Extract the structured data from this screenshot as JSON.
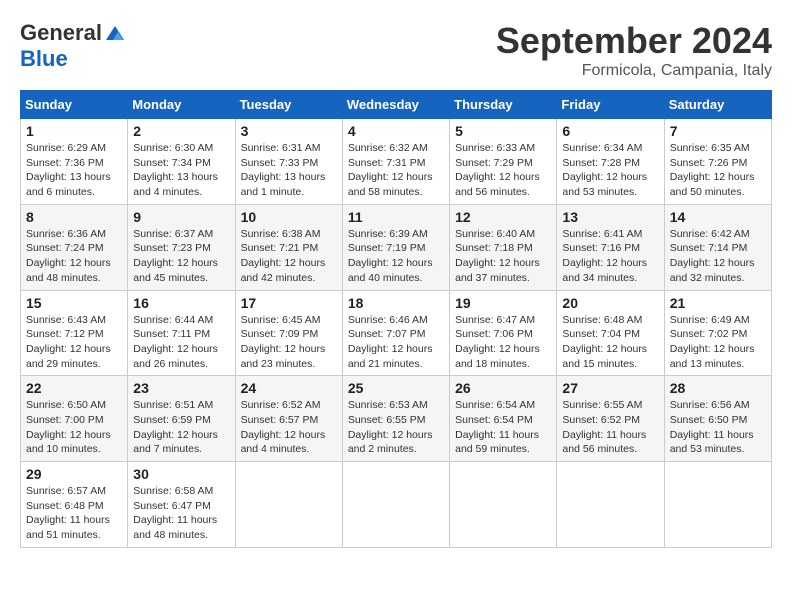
{
  "header": {
    "logo": {
      "general": "General",
      "blue": "Blue"
    },
    "title": "September 2024",
    "location": "Formicola, Campania, Italy"
  },
  "calendar": {
    "columns": [
      "Sunday",
      "Monday",
      "Tuesday",
      "Wednesday",
      "Thursday",
      "Friday",
      "Saturday"
    ],
    "weeks": [
      [
        null,
        null,
        null,
        null,
        null,
        null,
        null
      ]
    ],
    "days": {
      "1": {
        "num": "1",
        "sunrise": "6:29 AM",
        "sunset": "7:36 PM",
        "daylight": "13 hours and 6 minutes."
      },
      "2": {
        "num": "2",
        "sunrise": "6:30 AM",
        "sunset": "7:34 PM",
        "daylight": "13 hours and 4 minutes."
      },
      "3": {
        "num": "3",
        "sunrise": "6:31 AM",
        "sunset": "7:33 PM",
        "daylight": "13 hours and 1 minute."
      },
      "4": {
        "num": "4",
        "sunrise": "6:32 AM",
        "sunset": "7:31 PM",
        "daylight": "12 hours and 58 minutes."
      },
      "5": {
        "num": "5",
        "sunrise": "6:33 AM",
        "sunset": "7:29 PM",
        "daylight": "12 hours and 56 minutes."
      },
      "6": {
        "num": "6",
        "sunrise": "6:34 AM",
        "sunset": "7:28 PM",
        "daylight": "12 hours and 53 minutes."
      },
      "7": {
        "num": "7",
        "sunrise": "6:35 AM",
        "sunset": "7:26 PM",
        "daylight": "12 hours and 50 minutes."
      },
      "8": {
        "num": "8",
        "sunrise": "6:36 AM",
        "sunset": "7:24 PM",
        "daylight": "12 hours and 48 minutes."
      },
      "9": {
        "num": "9",
        "sunrise": "6:37 AM",
        "sunset": "7:23 PM",
        "daylight": "12 hours and 45 minutes."
      },
      "10": {
        "num": "10",
        "sunrise": "6:38 AM",
        "sunset": "7:21 PM",
        "daylight": "12 hours and 42 minutes."
      },
      "11": {
        "num": "11",
        "sunrise": "6:39 AM",
        "sunset": "7:19 PM",
        "daylight": "12 hours and 40 minutes."
      },
      "12": {
        "num": "12",
        "sunrise": "6:40 AM",
        "sunset": "7:18 PM",
        "daylight": "12 hours and 37 minutes."
      },
      "13": {
        "num": "13",
        "sunrise": "6:41 AM",
        "sunset": "7:16 PM",
        "daylight": "12 hours and 34 minutes."
      },
      "14": {
        "num": "14",
        "sunrise": "6:42 AM",
        "sunset": "7:14 PM",
        "daylight": "12 hours and 32 minutes."
      },
      "15": {
        "num": "15",
        "sunrise": "6:43 AM",
        "sunset": "7:12 PM",
        "daylight": "12 hours and 29 minutes."
      },
      "16": {
        "num": "16",
        "sunrise": "6:44 AM",
        "sunset": "7:11 PM",
        "daylight": "12 hours and 26 minutes."
      },
      "17": {
        "num": "17",
        "sunrise": "6:45 AM",
        "sunset": "7:09 PM",
        "daylight": "12 hours and 23 minutes."
      },
      "18": {
        "num": "18",
        "sunrise": "6:46 AM",
        "sunset": "7:07 PM",
        "daylight": "12 hours and 21 minutes."
      },
      "19": {
        "num": "19",
        "sunrise": "6:47 AM",
        "sunset": "7:06 PM",
        "daylight": "12 hours and 18 minutes."
      },
      "20": {
        "num": "20",
        "sunrise": "6:48 AM",
        "sunset": "7:04 PM",
        "daylight": "12 hours and 15 minutes."
      },
      "21": {
        "num": "21",
        "sunrise": "6:49 AM",
        "sunset": "7:02 PM",
        "daylight": "12 hours and 13 minutes."
      },
      "22": {
        "num": "22",
        "sunrise": "6:50 AM",
        "sunset": "7:00 PM",
        "daylight": "12 hours and 10 minutes."
      },
      "23": {
        "num": "23",
        "sunrise": "6:51 AM",
        "sunset": "6:59 PM",
        "daylight": "12 hours and 7 minutes."
      },
      "24": {
        "num": "24",
        "sunrise": "6:52 AM",
        "sunset": "6:57 PM",
        "daylight": "12 hours and 4 minutes."
      },
      "25": {
        "num": "25",
        "sunrise": "6:53 AM",
        "sunset": "6:55 PM",
        "daylight": "12 hours and 2 minutes."
      },
      "26": {
        "num": "26",
        "sunrise": "6:54 AM",
        "sunset": "6:54 PM",
        "daylight": "11 hours and 59 minutes."
      },
      "27": {
        "num": "27",
        "sunrise": "6:55 AM",
        "sunset": "6:52 PM",
        "daylight": "11 hours and 56 minutes."
      },
      "28": {
        "num": "28",
        "sunrise": "6:56 AM",
        "sunset": "6:50 PM",
        "daylight": "11 hours and 53 minutes."
      },
      "29": {
        "num": "29",
        "sunrise": "6:57 AM",
        "sunset": "6:48 PM",
        "daylight": "11 hours and 51 minutes."
      },
      "30": {
        "num": "30",
        "sunrise": "6:58 AM",
        "sunset": "6:47 PM",
        "daylight": "11 hours and 48 minutes."
      }
    }
  }
}
